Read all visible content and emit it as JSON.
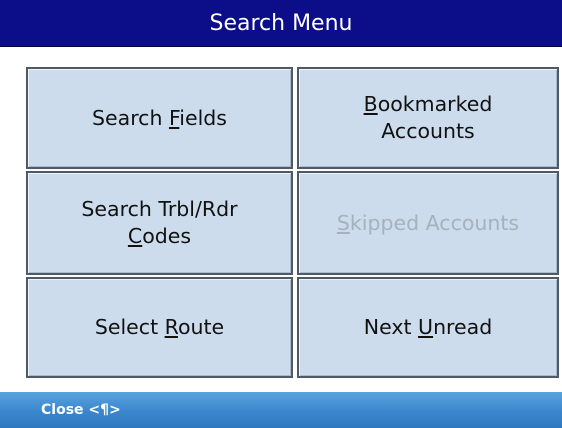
{
  "window": {
    "title": "Search Menu"
  },
  "colors": {
    "title_bar": "#0c0d88",
    "button_face": "#ccdcec",
    "button_border": "#505a66",
    "disabled_text": "#a7b1bb",
    "soft_key_bar": "#3a86cc"
  },
  "menu": {
    "buttons": [
      {
        "id": "search-fields",
        "line1_pre": "Search ",
        "line1_key": "F",
        "line1_post": "ields",
        "line2_pre": "",
        "line2_key": "",
        "line2_post": "",
        "enabled": true
      },
      {
        "id": "bookmarked-accounts",
        "line1_pre": "",
        "line1_key": "B",
        "line1_post": "ookmarked",
        "line2_pre": "Accounts",
        "line2_key": "",
        "line2_post": "",
        "enabled": true
      },
      {
        "id": "search-trbl-rdr-codes",
        "line1_pre": "Search Trbl/Rdr",
        "line1_key": "",
        "line1_post": "",
        "line2_pre": "",
        "line2_key": "C",
        "line2_post": "odes",
        "enabled": true
      },
      {
        "id": "skipped-accounts",
        "line1_pre": "",
        "line1_key": "S",
        "line1_post": "kipped Accounts",
        "line2_pre": "",
        "line2_key": "",
        "line2_post": "",
        "enabled": false
      },
      {
        "id": "select-route",
        "line1_pre": "Select ",
        "line1_key": "R",
        "line1_post": "oute",
        "line2_pre": "",
        "line2_key": "",
        "line2_post": "",
        "enabled": true
      },
      {
        "id": "next-unread",
        "line1_pre": "Next ",
        "line1_key": "U",
        "line1_post": "nread",
        "line2_pre": "",
        "line2_key": "",
        "line2_post": "",
        "enabled": true
      }
    ]
  },
  "soft_keys": {
    "left_label": "Close <¶>"
  }
}
